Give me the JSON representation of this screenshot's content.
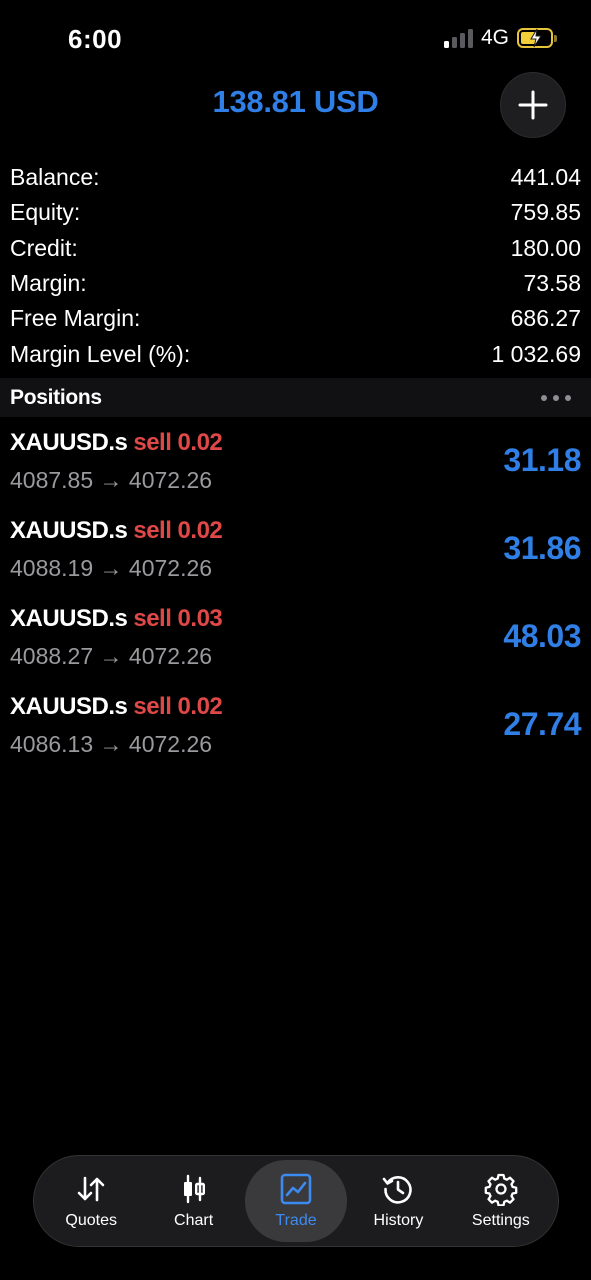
{
  "status_bar": {
    "time": "6:00",
    "network": "4G"
  },
  "header": {
    "title": "138.81 USD"
  },
  "summary": [
    {
      "label": "Balance:",
      "value": "441.04"
    },
    {
      "label": "Equity:",
      "value": "759.85"
    },
    {
      "label": "Credit:",
      "value": "180.00"
    },
    {
      "label": "Margin:",
      "value": "73.58"
    },
    {
      "label": "Free Margin:",
      "value": "686.27"
    },
    {
      "label": "Margin Level (%):",
      "value": "1 032.69"
    }
  ],
  "positions_section": {
    "title": "Positions"
  },
  "positions": [
    {
      "symbol": "XAUUSD.s",
      "side": "sell 0.02",
      "prices": "4087.85 → 4072.26",
      "profit": "31.18"
    },
    {
      "symbol": "XAUUSD.s",
      "side": "sell 0.02",
      "prices": "4088.19 → 4072.26",
      "profit": "31.86"
    },
    {
      "symbol": "XAUUSD.s",
      "side": "sell 0.03",
      "prices": "4088.27 → 4072.26",
      "profit": "48.03"
    },
    {
      "symbol": "XAUUSD.s",
      "side": "sell 0.02",
      "prices": "4086.13 → 4072.26",
      "profit": "27.74"
    }
  ],
  "tabbar": {
    "tabs": [
      {
        "label": "Quotes",
        "icon": "quotes-arrows-icon"
      },
      {
        "label": "Chart",
        "icon": "candlestick-icon"
      },
      {
        "label": "Trade",
        "icon": "trade-chart-icon",
        "active": true
      },
      {
        "label": "History",
        "icon": "history-clock-icon"
      },
      {
        "label": "Settings",
        "icon": "gear-icon"
      }
    ]
  },
  "colors": {
    "accent": "#2f7fe6",
    "sell": "#e04848",
    "background": "#000000"
  }
}
